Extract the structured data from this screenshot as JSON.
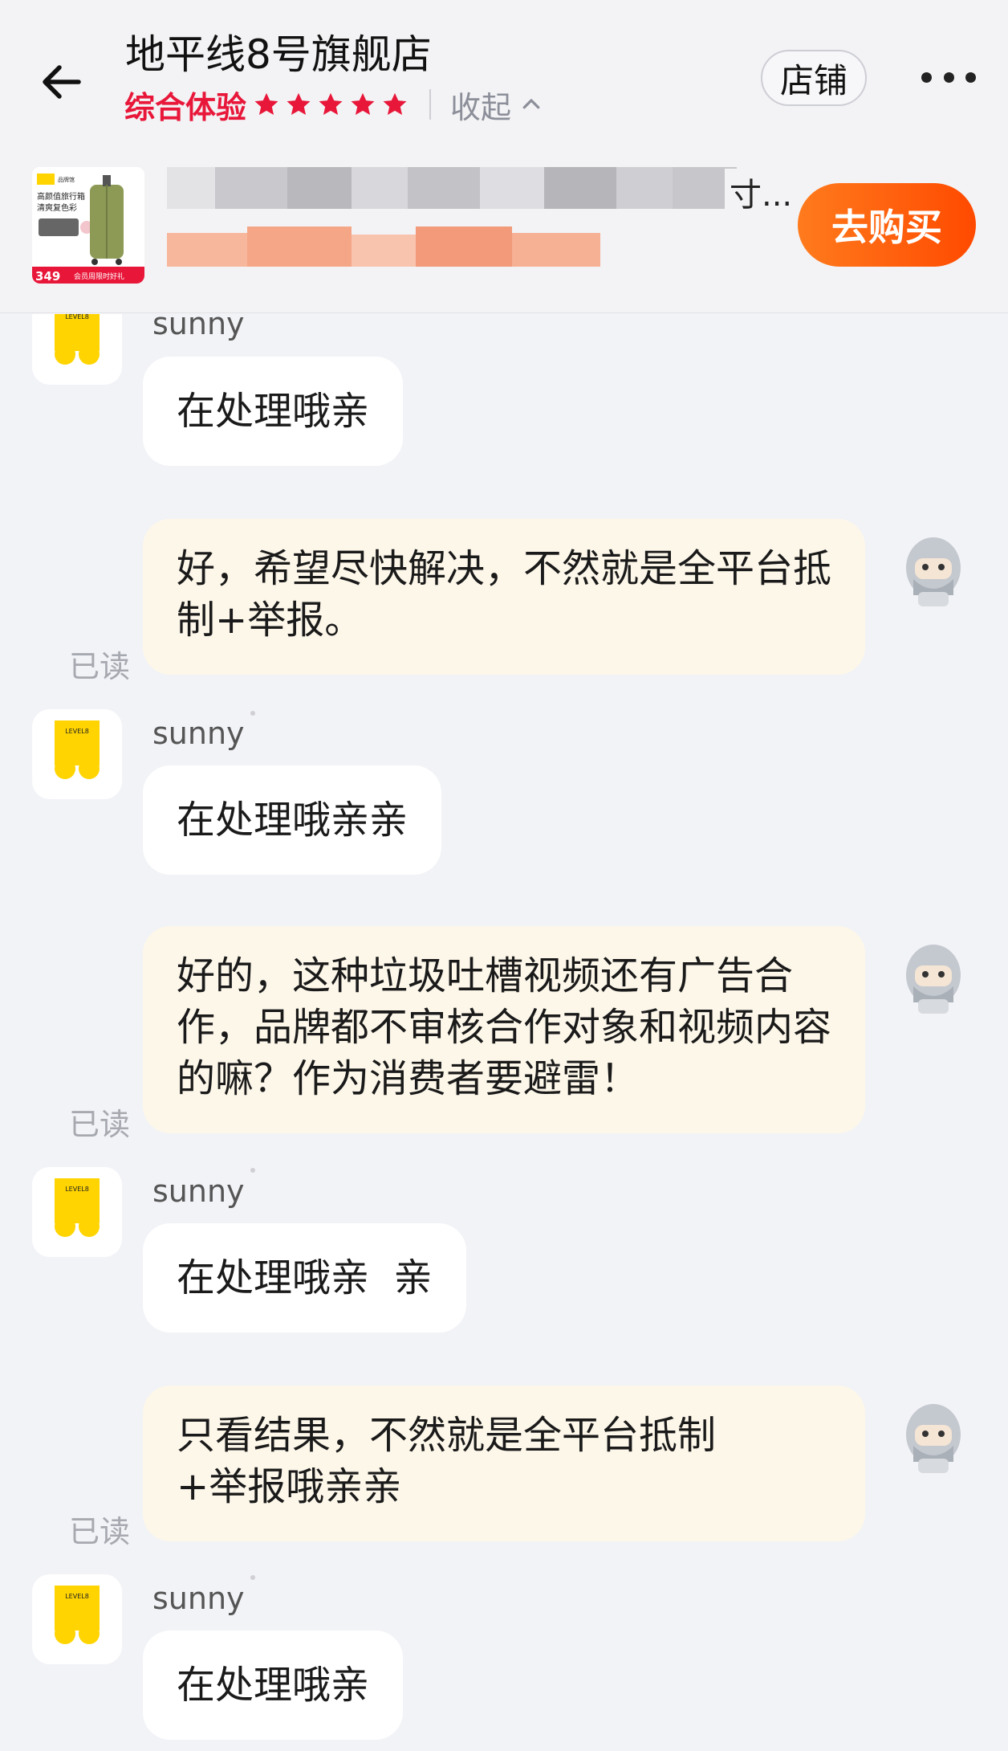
{
  "header": {
    "shop_name": "地平线8号旗舰店",
    "rating_label": "综合体验",
    "rating_stars": 5,
    "collapse_label": "收起",
    "store_button": "店铺"
  },
  "product": {
    "title_visible_text": "寸...",
    "buy_button": "去购买",
    "thumb_text_1": "高颜值旅行箱",
    "thumb_text_2": "清爽复色彩",
    "thumb_price": "349",
    "thumb_badge": "会员周限时好礼"
  },
  "messages": [
    {
      "side": "in",
      "sender": "sunny",
      "text": "在处理哦亲"
    },
    {
      "side": "out",
      "text": "好，希望尽快解决，不然就是全平台抵制+举报。",
      "status": "已读"
    },
    {
      "side": "in",
      "sender": "sunny",
      "text": "在处理哦亲亲"
    },
    {
      "side": "out",
      "text": "好的，这种垃圾吐槽视频还有广告合作，品牌都不审核合作对象和视频内容的嘛？作为消费者要避雷！",
      "status": "已读"
    },
    {
      "side": "in",
      "sender": "sunny",
      "text": "在处理哦亲  亲"
    },
    {
      "side": "out",
      "text": "只看结果，不然就是全平台抵制+举报哦亲亲",
      "status": "已读"
    },
    {
      "side": "in",
      "sender": "sunny",
      "text": "在处理哦亲"
    }
  ],
  "colors": {
    "accent_red": "#e8173a",
    "buy_orange": "#ff5a0a",
    "out_bubble": "#fdf7ea",
    "in_bubble": "#ffffff",
    "shop_avatar_yellow": "#ffd400"
  },
  "icons": {
    "back": "arrow-left-icon",
    "more": "more-dots-icon",
    "star": "star-icon",
    "chevron": "chevron-up-icon"
  }
}
